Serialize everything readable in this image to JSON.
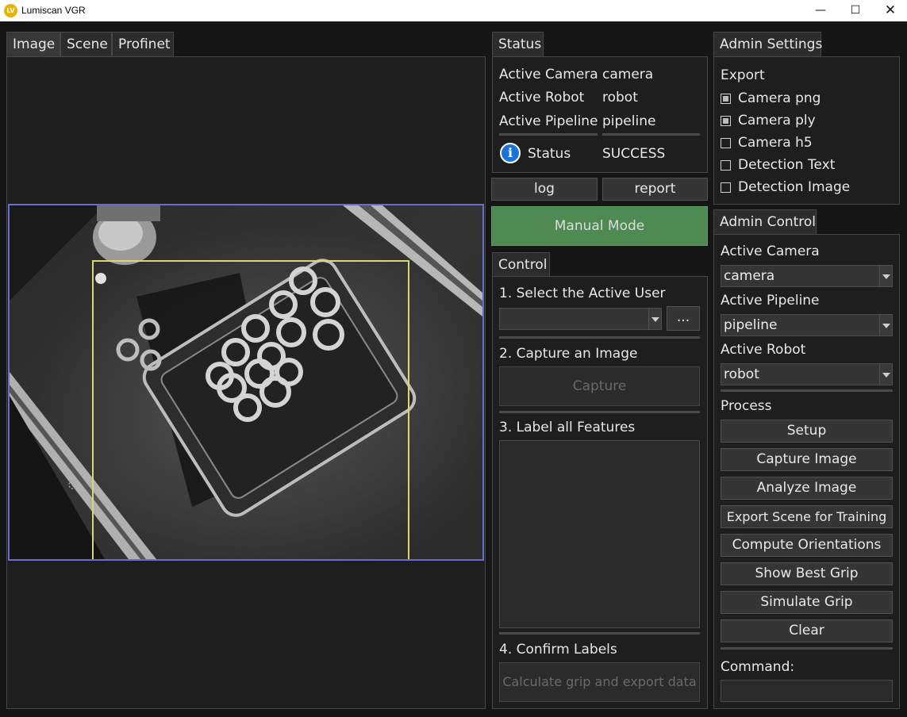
{
  "window": {
    "title": "Lumiscan VGR",
    "icon": "lumiscan-logo-icon",
    "controls": [
      "minimize-icon",
      "maximize-icon",
      "close-icon"
    ]
  },
  "tabs": {
    "viewer": [
      {
        "label": "Image",
        "active": true
      },
      {
        "label": "Scene",
        "active": false
      },
      {
        "label": "Profinet",
        "active": false
      }
    ],
    "status": "Status",
    "control": "Control",
    "admin_settings": "Admin Settings",
    "admin_control": "Admin Control"
  },
  "status": {
    "rows": [
      {
        "label": "Active Camera",
        "value": "camera"
      },
      {
        "label": "Active Robot",
        "value": "robot"
      },
      {
        "label": "Active Pipeline",
        "value": "pipeline"
      }
    ],
    "status_label": "Status",
    "status_value": "SUCCESS",
    "status_icon": "info-icon",
    "status_icon_color": "#1a73d9"
  },
  "buttons": {
    "log": "log",
    "report": "report",
    "mode": "Manual Mode",
    "mode_color": "#4f8a53"
  },
  "control": {
    "step1": "1. Select the Active User",
    "user_value": "",
    "browse": "...",
    "step2": "2. Capture an Image",
    "capture": "Capture",
    "step3": "3. Label all Features",
    "step4": "4. Confirm Labels",
    "calculate": "Calculate grip and export data"
  },
  "admin_settings": {
    "export_label": "Export",
    "options": [
      {
        "label": "Camera png",
        "checked": true
      },
      {
        "label": "Camera ply",
        "checked": true
      },
      {
        "label": "Camera h5",
        "checked": false
      },
      {
        "label": "Detection Text",
        "checked": false
      },
      {
        "label": "Detection Image",
        "checked": false
      }
    ]
  },
  "admin_control": {
    "camera_label": "Active Camera",
    "camera_value": "camera",
    "pipeline_label": "Active Pipeline",
    "pipeline_value": "pipeline",
    "robot_label": "Active Robot",
    "robot_value": "robot",
    "process_label": "Process",
    "process_buttons": [
      "Setup",
      "Capture Image",
      "Analyze Image",
      "Export Scene for Training",
      "Compute Orientations",
      "Show Best Grip",
      "Simulate Grip",
      "Clear"
    ],
    "command_label": "Command:",
    "command_value": ""
  },
  "colors": {
    "viewer_border": "#6c6ccc",
    "roi_border": "#d8d870"
  }
}
